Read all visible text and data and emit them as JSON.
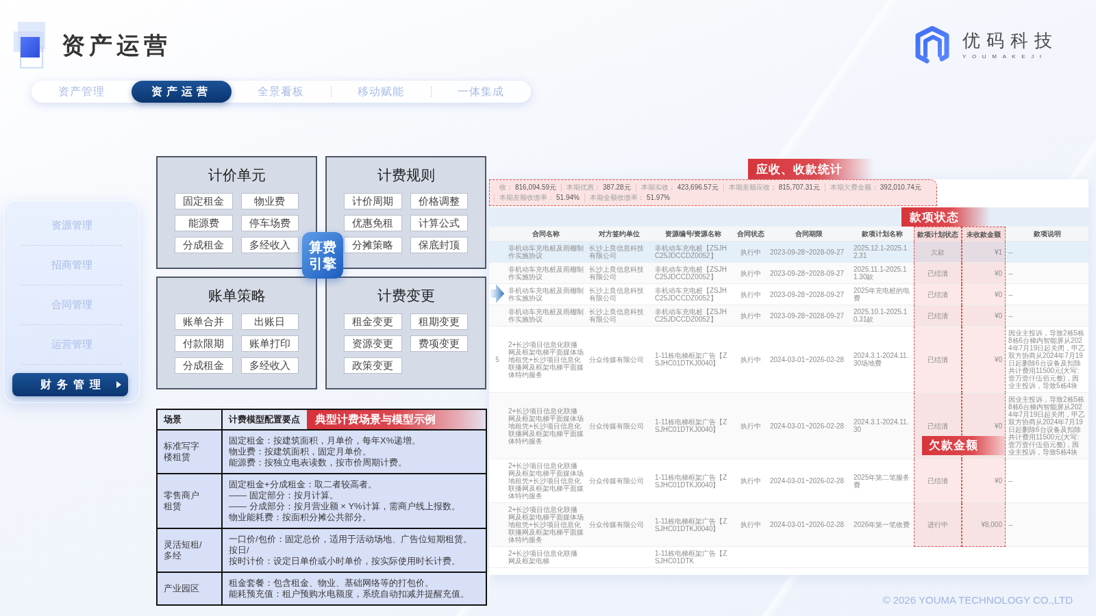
{
  "header": {
    "title": "资产运营",
    "brand": {
      "name": "优码科技",
      "tagline": "YOUMAKEJI"
    }
  },
  "tabs": [
    {
      "label": "资产管理",
      "selected": false
    },
    {
      "label": "资产运营",
      "selected": true
    },
    {
      "label": "全景看板",
      "selected": false
    },
    {
      "label": "移动赋能",
      "selected": false
    },
    {
      "label": "一体集成",
      "selected": false
    }
  ],
  "sidebar": {
    "items": [
      {
        "label": "资源管理",
        "selected": false
      },
      {
        "label": "招商管理",
        "selected": false
      },
      {
        "label": "合同管理",
        "selected": false
      },
      {
        "label": "运营管理",
        "selected": false
      },
      {
        "label": "财务管理",
        "selected": true
      }
    ]
  },
  "engine_diagram": {
    "center": "算费引擎",
    "groups": [
      {
        "title": "计价单元",
        "items": [
          "固定租金",
          "物业费",
          "能源费",
          "停车场费",
          "分成租金",
          "多经收入"
        ]
      },
      {
        "title": "计费规则",
        "items": [
          "计价周期",
          "价格调整",
          "优惠免租",
          "计算公式",
          "分摊策略",
          "保底封顶"
        ]
      },
      {
        "title": "账单策略",
        "items": [
          "账单合并",
          "出账日",
          "付款限期",
          "账单打印",
          "分成租金",
          "多经收入"
        ]
      },
      {
        "title": "计费变更",
        "items": [
          "租金变更",
          "租期变更",
          "资源变更",
          "费项变更",
          "政策变更"
        ]
      }
    ]
  },
  "scenario_table": {
    "banner": "典型计费场景与模型示例",
    "columns": [
      "场景",
      "计费模型配置要点"
    ],
    "rows": [
      {
        "scene": "标准写字楼租赁",
        "points": [
          "固定租金：按建筑面积，月单价，每年X%递增。",
          "物业费：按建筑面积，固定月单价。",
          "能源费：按独立电表读数，按市价周期计费。"
        ]
      },
      {
        "scene": "零售商户租赁",
        "points": [
          "固定租金+分成租金：取二者较高者。",
          "—— 固定部分：按月计算。",
          "—— 分成部分：按月营业额 × Y%计算，需商户线上报数。",
          "物业能耗费：按面积分摊公共部分。"
        ]
      },
      {
        "scene": "灵活短租/多经",
        "points": [
          "一口价/包价：固定总价，适用于活动场地、广告位短期租赁。",
          "按日/",
          "按时计价：设定日单价或小时单价，按实际使用时长计费。"
        ]
      },
      {
        "scene": "产业园区",
        "points": [
          "租金套餐：包含租金、物业、基础网络等的打包价。",
          "能耗预充值：租户预购水电额度，系统自动扣减并提醒充值。"
        ]
      }
    ]
  },
  "billing_screenshot": {
    "stats_title": "应收、收款统计",
    "stats": [
      {
        "label": "收：",
        "value": "816,094.59元"
      },
      {
        "label": "本期优惠：",
        "value": "387.28元"
      },
      {
        "label": "本期实收：",
        "value": "423,696.57元"
      },
      {
        "label": "本期差额应收：",
        "value": "815,707.31元"
      },
      {
        "label": "本期欠费金额：",
        "value": "392,010.74元"
      },
      {
        "label": "本期差额收缴率：",
        "value": "51.94%"
      },
      {
        "label": "本期全额收缴率：",
        "value": "51.97%"
      }
    ],
    "status_title": "款项状态",
    "columns": [
      {
        "label": "合同名称",
        "highlighted": false
      },
      {
        "label": "对方签约单位",
        "highlighted": false
      },
      {
        "label": "资源编号/资源名称",
        "highlighted": false
      },
      {
        "label": "合同状态",
        "highlighted": false
      },
      {
        "label": "合同期限",
        "highlighted": false
      },
      {
        "label": "款项计划名称",
        "highlighted": false
      },
      {
        "label": "款项计划状态",
        "highlighted": true
      },
      {
        "label": "未收款金额",
        "highlighted": true
      },
      {
        "label": "款项说明",
        "highlighted": false
      }
    ],
    "rows": [
      {
        "contract": "非机动车充电桩及雨棚制作实施协议",
        "counterparty": "长沙上良信息科技有限公司",
        "resource": "非机动车充电桩【ZSJHC25JDCCDZ0052】",
        "contract_status": "执行中",
        "term": "2023-09-28~2028-09-27",
        "plan_name": "2025.12.1-2025.12.31",
        "plan_status": "欠款",
        "unpaid": "¥1",
        "note": "--",
        "selected": true
      },
      {
        "contract": "非机动车充电桩及雨棚制作实施协议",
        "counterparty": "长沙上良信息科技有限公司",
        "resource": "非机动车充电桩【ZSJHC25JDCCDZ0052】",
        "contract_status": "执行中",
        "term": "2023-09-28~2028-09-27",
        "plan_name": "2025.11.1-2025.11.30款",
        "plan_status": "已结清",
        "unpaid": "¥0",
        "note": "--",
        "selected": false
      },
      {
        "contract": "非机动车充电桩及雨棚制作实施协议",
        "counterparty": "长沙上良信息科技有限公司",
        "resource": "非机动车充电桩【ZSJHC25JDCCDZ0052】",
        "contract_status": "执行中",
        "term": "2023-09-28~2028-09-27",
        "plan_name": "2025年充电桩的电费",
        "plan_status": "已结清",
        "unpaid": "¥0",
        "note": "--",
        "selected": false
      },
      {
        "contract": "非机动车充电桩及雨棚制作实施协议",
        "counterparty": "长沙上良信息科技有限公司",
        "resource": "非机动车充电桩【ZSJHC25JDCCDZ0052】",
        "contract_status": "执行中",
        "term": "2023-09-28~2028-09-27",
        "plan_name": "2025.10.1-2025.10.31款",
        "plan_status": "已结清",
        "unpaid": "¥0",
        "note": "--",
        "selected": false
      },
      {
        "index": "5",
        "contract": "2+长沙项目信息化联播网及框架电梯平面媒体场地租凭+长沙项目信息化联播网及框架电梯平面媒体特约服务",
        "counterparty": "分众传媒有限公司",
        "resource": "1-11栋电梯框架广告【ZSJHC01DTKJ0040】",
        "contract_status": "执行中",
        "term": "2024-03-01~2026-02-28",
        "plan_name": "2024.3.1-2024.11.30场地费",
        "plan_status": "已结清",
        "unpaid": "¥0",
        "note": "因业主投诉，导致2栋5栋8栋6台梯内智能屏从2024年7月19日起关闭，甲乙双方协商从2024年7月19日起删除6台设备及扣除共计费用11500元(大写:壹万壹仟伍佰元整)，因业主投诉，导致5栋4块",
        "selected": false
      },
      {
        "contract": "2+长沙项目信息化联播网及框架电梯平面媒体场地租凭+长沙项目信息化联播网及框架电梯平面媒体特约服务",
        "counterparty": "分众传媒有限公司",
        "resource": "1-11栋电梯框架广告【ZSJHC01DTKJ0040】",
        "contract_status": "执行中",
        "term": "2024-03-01~2026-02-28",
        "plan_name": "2024.3.1-2024.11.30",
        "plan_status": "已结清",
        "unpaid": "¥0",
        "note": "因业主投诉，导致2栋5栋8栋6台梯内智能屏从2024年7月19日起关闭，甲乙双方协商从2024年7月19日起删除6台设备及扣除共计费用11500元(大写:壹万壹仟伍佰元整)，因业主投诉，导致5栋4块",
        "callout": "欠款金额",
        "selected": false
      },
      {
        "contract": "2+长沙项目信息化联播网及框架电梯平面媒体场地租凭+长沙项目信息化联播网及框架电梯平面媒体特约服务",
        "counterparty": "分众传媒有限公司",
        "resource": "1-11栋电梯框架广告【ZSJHC01DTKJ0040】",
        "contract_status": "执行中",
        "term": "2024-03-01~2026-02-28",
        "plan_name": "2025年第二笔服务费",
        "plan_status": "已结清",
        "unpaid": "¥0",
        "note": "--",
        "selected": false
      },
      {
        "contract": "2+长沙项目信息化联播网及框架电梯平面媒体场地租凭+长沙项目信息化联播网及框架电梯平面媒体特约服务",
        "counterparty": "分众传媒有限公司",
        "resource": "1-11栋电梯框架广告【ZSJHC01DTKJ0040】",
        "contract_status": "执行中",
        "term": "2024-03-01~2026-02-28",
        "plan_name": "2026年第一笔收费",
        "plan_status": "进行中",
        "unpaid": "¥8,000",
        "note": "--",
        "selected": false
      }
    ],
    "cut_row": {
      "contract": "2+长沙项目信息化联播网及框架电梯",
      "resource": "1-11栋电梯框架广告【ZSJHC01DTK"
    }
  },
  "footer": {
    "copyright": "© 2026 YOUMA TECHNOLOGY CO.,LTD"
  }
}
